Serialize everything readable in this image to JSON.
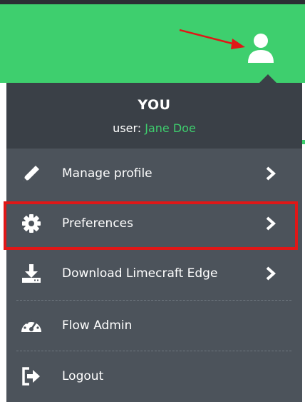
{
  "header": {
    "avatar_icon": "user-icon",
    "accent_color": "#3ecf6e",
    "annotation_arrow_color": "#e01717"
  },
  "menu": {
    "title": "YOU",
    "user_prefix": "user: ",
    "user_name": "Jane Doe",
    "items": [
      {
        "label": "Manage profile",
        "icon": "pencil-icon",
        "has_submenu": true
      },
      {
        "label": "Preferences",
        "icon": "gear-icon",
        "has_submenu": true,
        "highlighted": true
      },
      {
        "label": "Download Limecraft Edge",
        "icon": "download-icon",
        "has_submenu": true
      },
      {
        "label": "Flow Admin",
        "icon": "dashboard-icon",
        "has_submenu": false
      },
      {
        "label": "Logout",
        "icon": "logout-icon",
        "has_submenu": false
      }
    ]
  }
}
